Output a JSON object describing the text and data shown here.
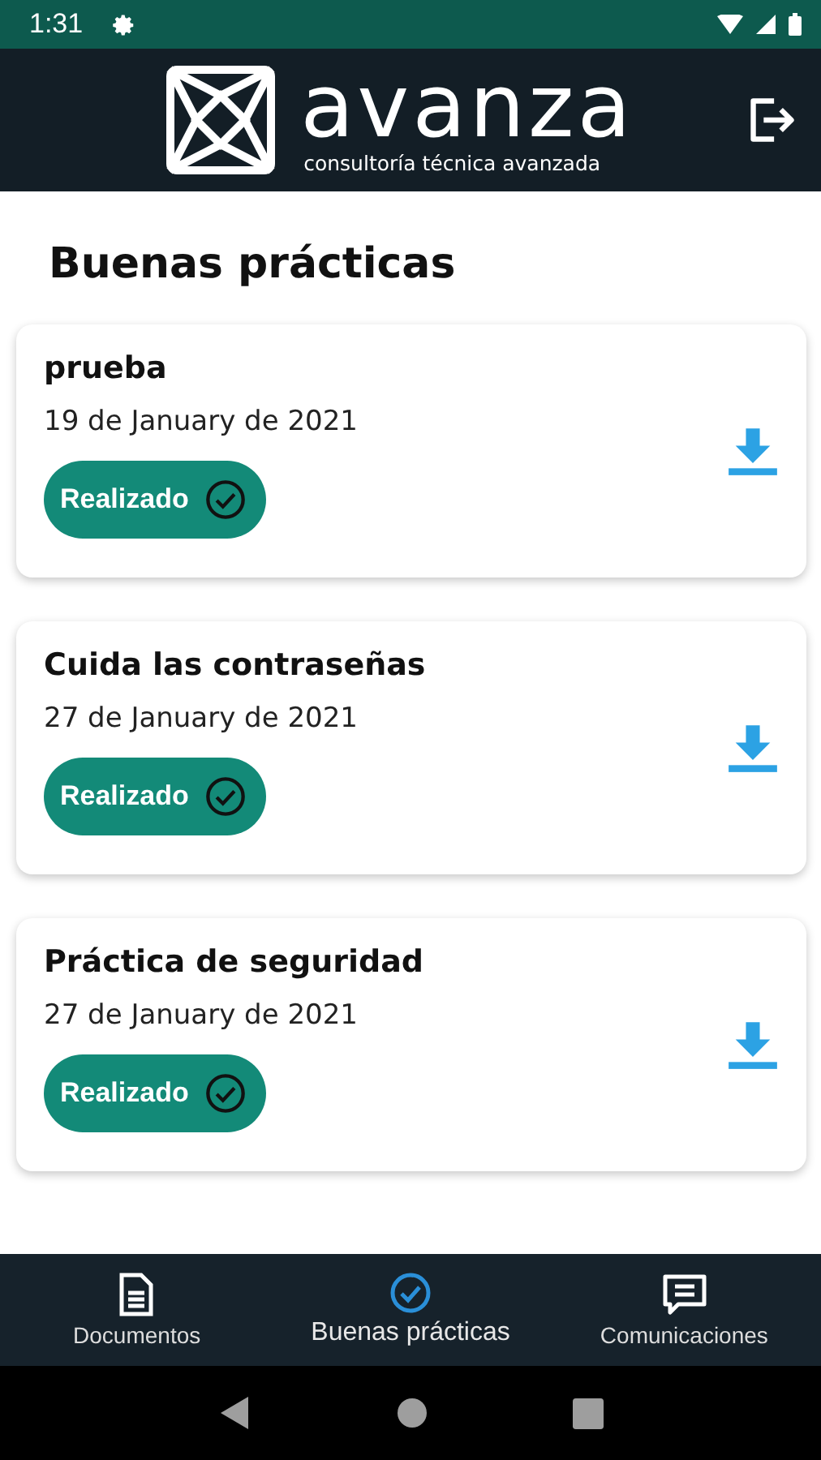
{
  "status_bar": {
    "time": "1:31"
  },
  "header": {
    "brand": "avanza",
    "tagline": "consultoría técnica avanzada"
  },
  "page_title": "Buenas prácticas",
  "cards": [
    {
      "title": "prueba",
      "date": "19 de January de 2021",
      "status": "Realizado"
    },
    {
      "title": "Cuida las contraseñas",
      "date": "27 de January de 2021",
      "status": "Realizado"
    },
    {
      "title": "Práctica de seguridad",
      "date": "27 de January de 2021",
      "status": "Realizado"
    }
  ],
  "bottom_nav": [
    {
      "kind": "document",
      "label": "Documentos",
      "selected": false
    },
    {
      "kind": "check",
      "label": "Buenas prácticas",
      "selected": true
    },
    {
      "kind": "chat",
      "label": "Comunicaciones",
      "selected": false
    }
  ]
}
